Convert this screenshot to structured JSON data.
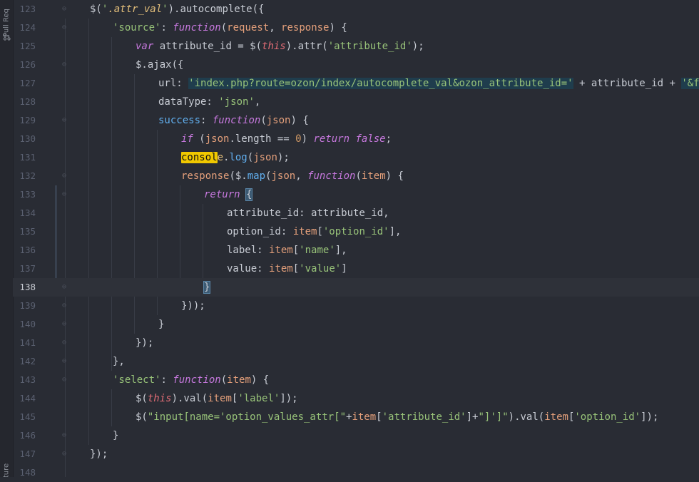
{
  "sidebar": {
    "pull_requests_tab": "Pull Req",
    "bottom_tab": "ture"
  },
  "editor": {
    "current_line": "138",
    "line_numbers": [
      "123",
      "124",
      "125",
      "126",
      "127",
      "128",
      "129",
      "130",
      "131",
      "132",
      "133",
      "134",
      "135",
      "136",
      "137",
      "138",
      "139",
      "140",
      "141",
      "142",
      "143",
      "144",
      "145",
      "146",
      "147",
      "148"
    ]
  },
  "colors": {
    "background": "#292c34",
    "keyword": "#c678dd",
    "string": "#98c379",
    "property": "#61afef",
    "this": "#e06c75",
    "number": "#d19a66",
    "search_highlight": "#f0c800"
  }
}
